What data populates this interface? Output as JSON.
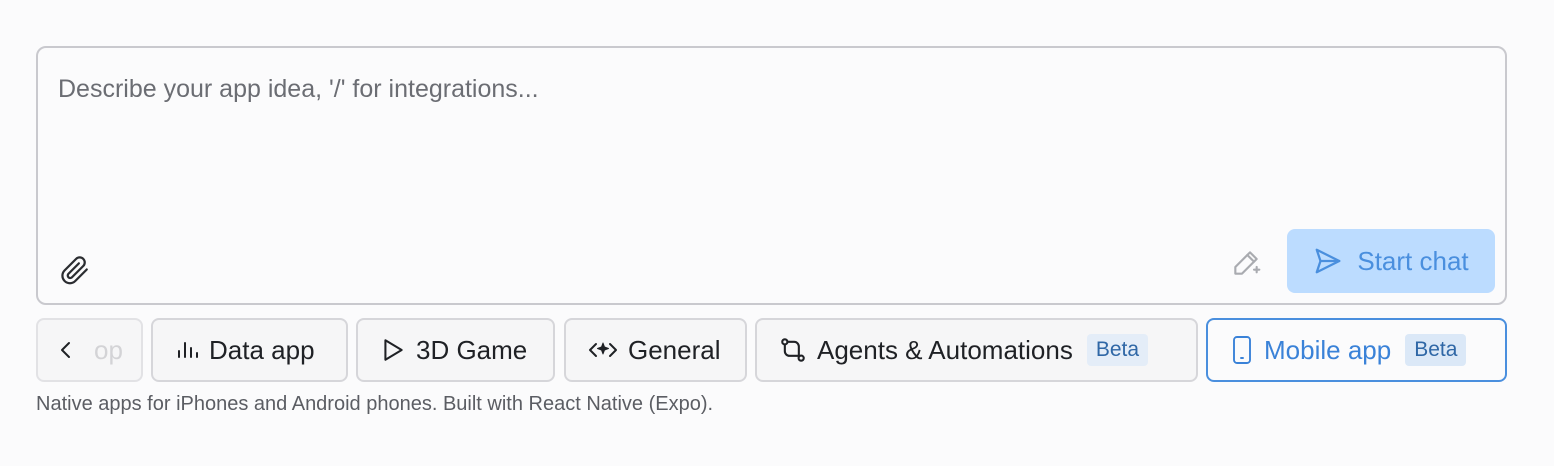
{
  "composer": {
    "placeholder": "Describe your app idea, '/' for integrations...",
    "value": "",
    "attach_icon": "paperclip-icon",
    "enhance_icon": "pen-sparkle-icon",
    "start_button": {
      "label": "Start chat",
      "icon": "send-icon",
      "color": "#4a8fde",
      "background": "#bcdcff"
    }
  },
  "app_types": {
    "prev_partial_label": "op",
    "items": [
      {
        "label": "Data app",
        "icon": "bar-chart-icon",
        "badge": null,
        "selected": false
      },
      {
        "label": "3D Game",
        "icon": "play-icon",
        "badge": null,
        "selected": false
      },
      {
        "label": "General",
        "icon": "code-sparkle-icon",
        "badge": null,
        "selected": false
      },
      {
        "label": "Agents & Automations",
        "icon": "workflow-icon",
        "badge": "Beta",
        "selected": false
      },
      {
        "label": "Mobile app",
        "icon": "phone-icon",
        "badge": "Beta",
        "selected": true
      }
    ]
  },
  "helper_text": "Native apps for iPhones and Android phones. Built with React Native (Expo).",
  "colors": {
    "accent": "#4a8fde",
    "border": "#c9c9ce"
  }
}
